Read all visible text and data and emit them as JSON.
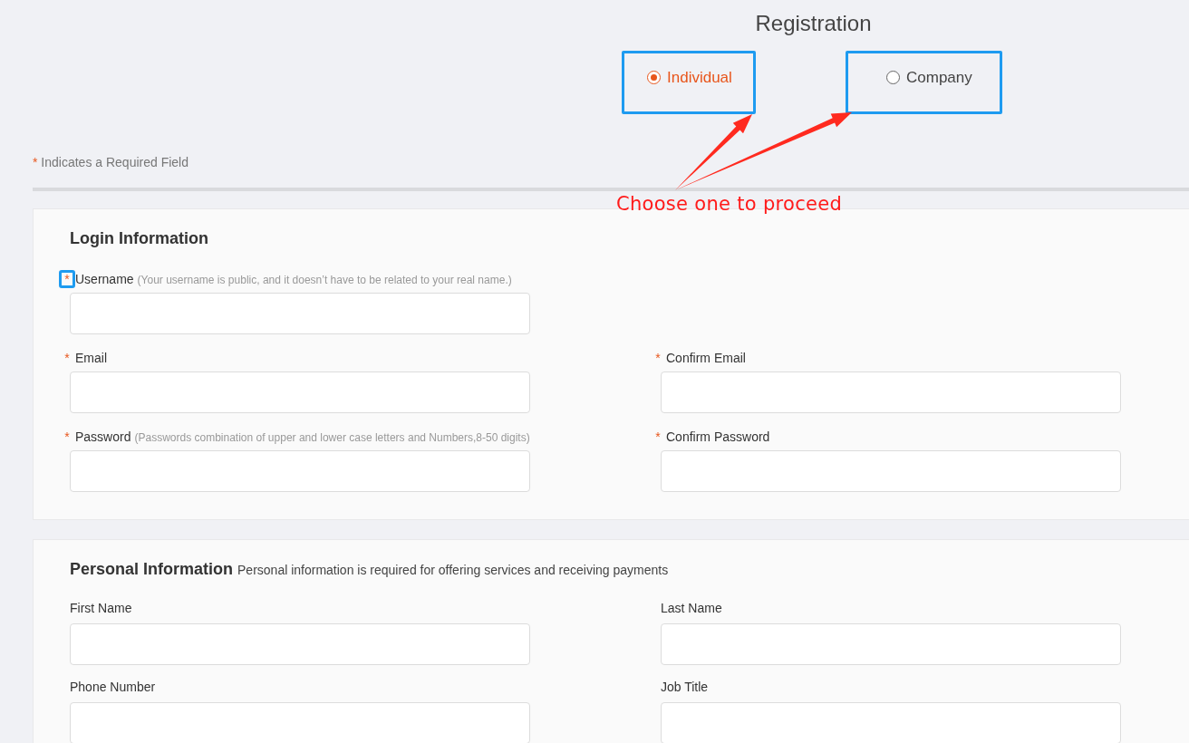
{
  "title": "Registration",
  "account_types": [
    {
      "label": "Individual",
      "selected": true,
      "highlighted": true
    },
    {
      "label": "Company",
      "selected": false,
      "highlighted": true
    }
  ],
  "required_note": {
    "mark": "*",
    "text": "Indicates a Required Field"
  },
  "annotation": {
    "text": "Choose one to proceed"
  },
  "sections": [
    {
      "title": "Login Information",
      "fields": [
        {
          "kind": "full",
          "mark": "*",
          "label": "Username",
          "hint": "(Your username is public, and it doesn’t have to be related to your real name.)",
          "highlighted": true
        },
        {
          "kind": "half",
          "mark": "*",
          "label": "Email"
        },
        {
          "kind": "half",
          "mark": "*",
          "label": "Confirm Email"
        },
        {
          "kind": "half",
          "mark": "*",
          "label": "Password",
          "hint": "(Passwords combination of upper and lower case letters and Numbers,8-50 digits)"
        },
        {
          "kind": "half",
          "mark": "*",
          "label": "Confirm Password"
        }
      ]
    },
    {
      "title": "Personal Information",
      "note": "Personal information is required for offering services and receiving payments",
      "fields": [
        {
          "kind": "half",
          "label": "First Name"
        },
        {
          "kind": "half",
          "label": "Last Name"
        },
        {
          "kind": "half",
          "label": "Phone Number"
        },
        {
          "kind": "half",
          "label": "Job Title"
        }
      ]
    }
  ]
}
